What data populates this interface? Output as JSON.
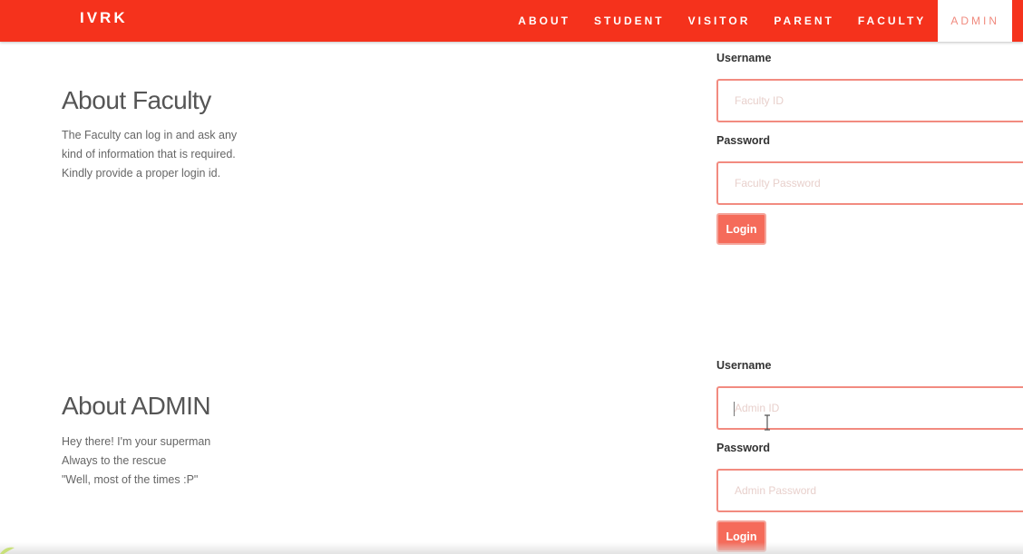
{
  "brand": "IVRK",
  "nav": {
    "items": [
      {
        "label": "ABOUT",
        "active": false
      },
      {
        "label": "STUDENT",
        "active": false
      },
      {
        "label": "VISITOR",
        "active": false
      },
      {
        "label": "PARENT",
        "active": false
      },
      {
        "label": "FACULTY",
        "active": false
      },
      {
        "label": "ADMIN",
        "active": true
      }
    ]
  },
  "faculty": {
    "title": "About Faculty",
    "desc_lines": [
      "The Faculty can log in and ask any",
      "kind of information that is required.",
      "Kindly provide a proper login id."
    ],
    "username_label": "Username",
    "username_placeholder": "Faculty ID",
    "password_label": "Password",
    "password_placeholder": "Faculty Password",
    "login_label": "Login"
  },
  "admin": {
    "title": "About ADMIN",
    "desc_lines": [
      "Hey there! I'm your superman",
      "Always to the rescue",
      "\"Well, most of the times :P\""
    ],
    "username_label": "Username",
    "username_placeholder": "Admin ID",
    "password_label": "Password",
    "password_placeholder": "Admin Password",
    "login_label": "Login"
  },
  "colors": {
    "navbar": "#f5321c",
    "accent": "#f56b5a",
    "input_border": "#f28b80"
  },
  "icons": {
    "cursor": "text-cursor-icon"
  }
}
